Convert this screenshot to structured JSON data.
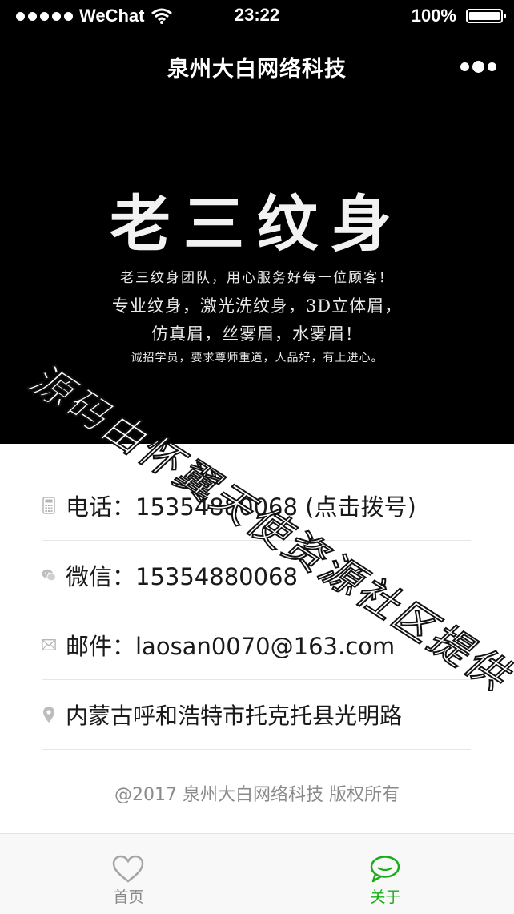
{
  "status_bar": {
    "carrier": "WeChat",
    "time": "23:22",
    "battery": "100%"
  },
  "nav": {
    "title": "泉州大白网络科技",
    "more_icon": "more-dots-icon"
  },
  "banner": {
    "title": "老三纹身",
    "lines": [
      "老三纹身团队，用心服务好每一位顾客！",
      "专业纹身，激光洗纹身，3D立体眉，",
      "仿真眉，丝雾眉，水雾眉！",
      "诚招学员，要求尊师重道，人品好，有上进心。"
    ]
  },
  "contacts": {
    "phone": {
      "icon": "calculator-icon",
      "text": "电话：15354880068 (点击拨号)"
    },
    "wechat": {
      "icon": "wechat-icon",
      "text": "微信：15354880068"
    },
    "email": {
      "icon": "mail-icon",
      "text": "邮件：laosan0070@163.com"
    },
    "address": {
      "icon": "location-pin-icon",
      "text": "内蒙古呼和浩特市托克托县光明路"
    }
  },
  "footer": {
    "copyright": "@2017 泉州大白网络科技 版权所有"
  },
  "tabbar": {
    "home_label": "首页",
    "about_label": "关于"
  },
  "watermark": {
    "text": "源码由怀翼天使资源社区提供"
  },
  "colors": {
    "accent": "#1aad19",
    "header_bg": "#000000",
    "muted": "#8a8a8a"
  }
}
